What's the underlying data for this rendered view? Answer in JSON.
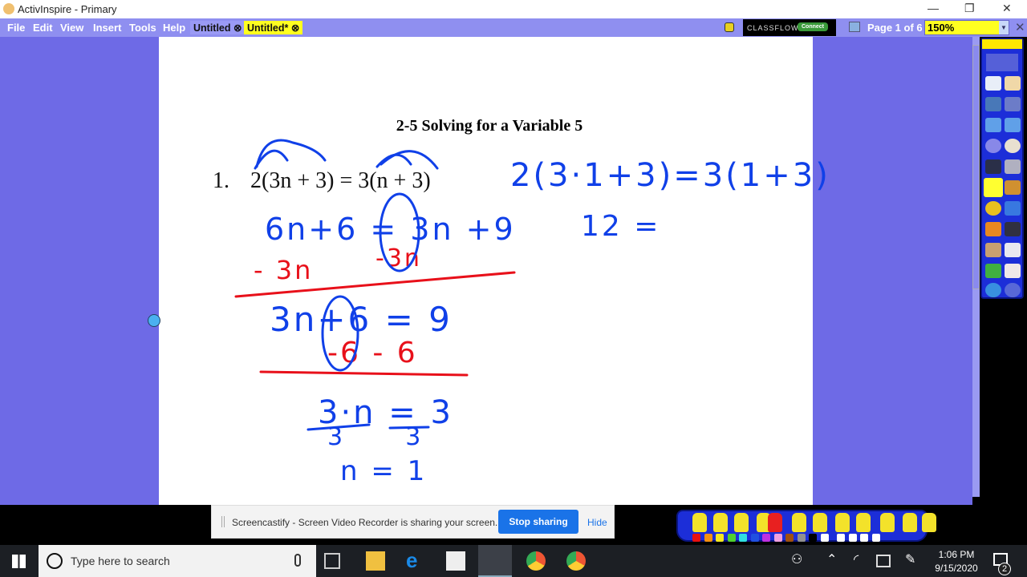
{
  "window": {
    "title": "ActivInspire - Primary",
    "controls": [
      "—",
      "❐",
      "✕"
    ]
  },
  "menu": [
    "File",
    "Edit",
    "View",
    "Insert",
    "Tools",
    "Help"
  ],
  "tabs": [
    {
      "label": "Untitled ⊗",
      "active": false
    },
    {
      "label": "Untitled* ⊗",
      "active": true
    }
  ],
  "classflow": {
    "label": "CLASSFLOW",
    "button": "Connect"
  },
  "page_indicator": "Page 1 of 6",
  "zoom": "150%",
  "worksheet": {
    "title": "2-5  Solving for a Variable 5",
    "number": "1.",
    "problem": "2(3n + 3) = 3(n + 3)"
  },
  "ink": {
    "line1": "6n+6 = 3n +9",
    "sub1_left": "- 3n",
    "sub1_right": "-3n",
    "line2": "3n+6 = 9",
    "sub2": "-6  - 6",
    "line3_num": "3·n = 3",
    "line3_den": "3      3",
    "answer": "n = 1",
    "check1": "2(3·1+3)=3(1+3)",
    "check2": "12 =",
    "blue": "#1040e8",
    "red": "#e8101a"
  },
  "share_bar": {
    "message": "Screencastify - Screen Video Recorder is sharing your screen.",
    "stop": "Stop sharing",
    "hide": "Hide"
  },
  "taskbar": {
    "search_placeholder": "Type here to search",
    "time": "1:06 PM",
    "date": "9/15/2020",
    "notifications": "2"
  },
  "pen_colors": [
    "#e81010",
    "#f59010",
    "#f5e820",
    "#50d030",
    "#30e0e0",
    "#2050e0",
    "#c030e0",
    "#f0a0e0",
    "#a05010",
    "#909090",
    "#000000",
    "#ffffff",
    "#ffffff",
    "#ffffff",
    "#ffffff",
    "#ffffff"
  ]
}
